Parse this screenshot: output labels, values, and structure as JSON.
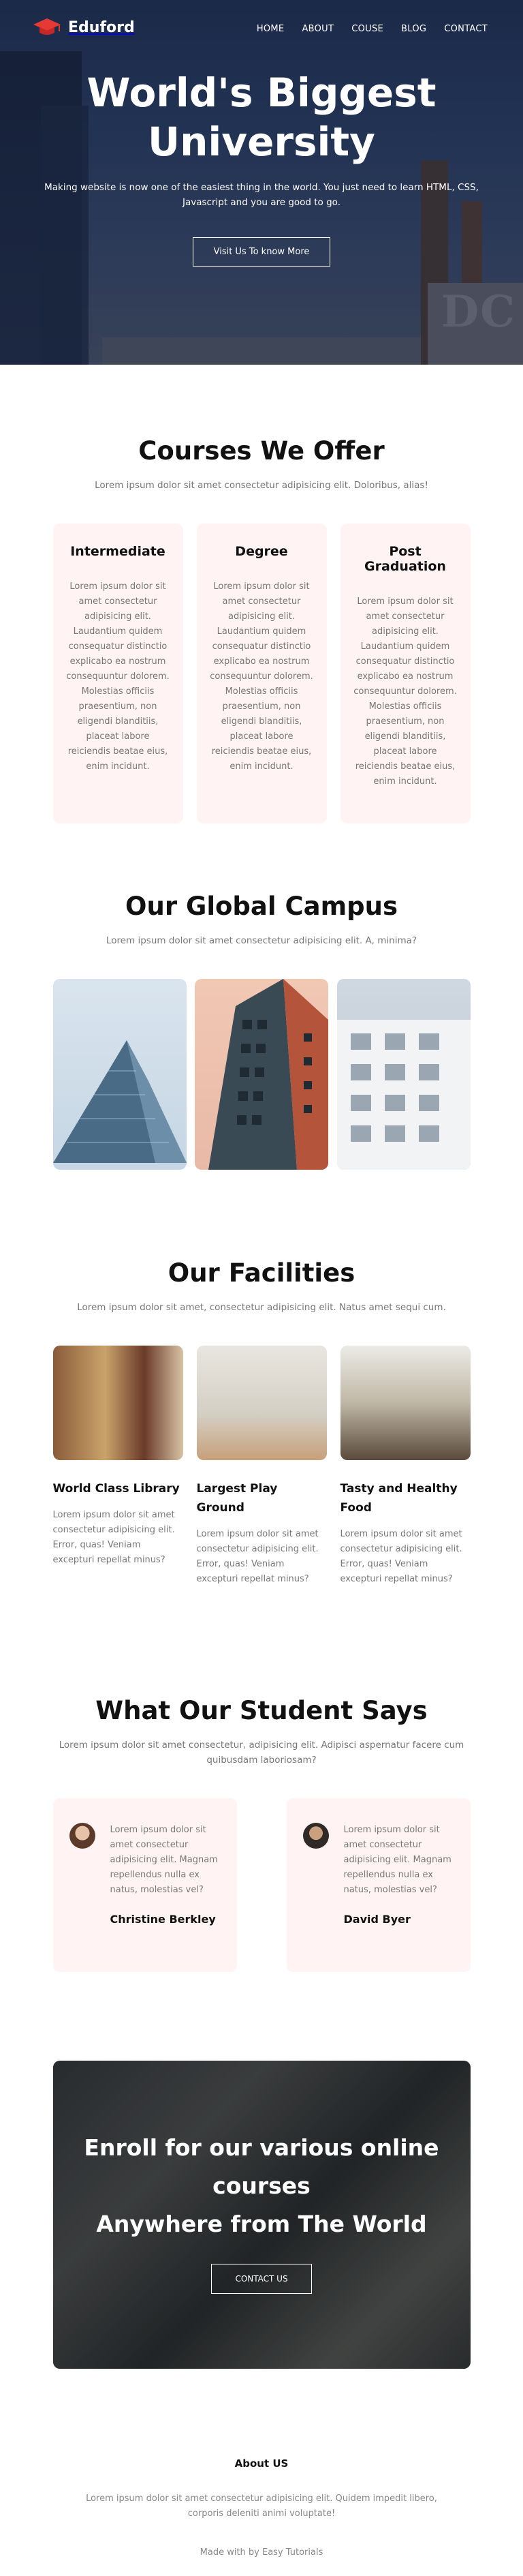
{
  "brand": {
    "name": "Eduford",
    "accent": "#f44336"
  },
  "nav": {
    "links": [
      "HOME",
      "ABOUT",
      "COUSE",
      "BLOG",
      "CONTACT"
    ]
  },
  "hero": {
    "title": "World's Biggest University",
    "subtitle": "Making website is now one of the easiest thing in the world. You just need to learn HTML, CSS, Javascript and you are good to go.",
    "button": "Visit Us To know More",
    "watermark": "DC"
  },
  "courses": {
    "title": "Courses We Offer",
    "subtitle": "Lorem ipsum dolor sit amet consectetur adipisicing elit. Doloribus, alias!",
    "items": [
      {
        "title": "Intermediate",
        "text": "Lorem ipsum dolor sit amet consectetur adipisicing elit. Laudantium quidem consequatur distinctio explicabo ea nostrum consequuntur dolorem. Molestias officiis praesentium, non eligendi blanditiis, placeat labore reiciendis beatae eius, enim incidunt."
      },
      {
        "title": "Degree",
        "text": "Lorem ipsum dolor sit amet consectetur adipisicing elit. Laudantium quidem consequatur distinctio explicabo ea nostrum consequuntur dolorem. Molestias officiis praesentium, non eligendi blanditiis, placeat labore reiciendis beatae eius, enim incidunt."
      },
      {
        "title": "Post Graduation",
        "text": "Lorem ipsum dolor sit amet consectetur adipisicing elit. Laudantium quidem consequatur distinctio explicabo ea nostrum consequuntur dolorem. Molestias officiis praesentium, non eligendi blanditiis, placeat labore reiciendis beatae eius, enim incidunt."
      }
    ]
  },
  "campus": {
    "title": "Our Global Campus",
    "subtitle": "Lorem ipsum dolor sit amet consectetur adipisicing elit. A, minima?"
  },
  "facilities": {
    "title": "Our Facilities",
    "subtitle": "Lorem ipsum dolor sit amet, consectetur adipisicing elit. Natus amet sequi cum.",
    "items": [
      {
        "title": "World Class Library",
        "text": "Lorem ipsum dolor sit amet consectetur adipisicing elit. Error, quas! Veniam excepturi repellat minus?"
      },
      {
        "title": "Largest Play Ground",
        "text": "Lorem ipsum dolor sit amet consectetur adipisicing elit. Error, quas! Veniam excepturi repellat minus?"
      },
      {
        "title": "Tasty and Healthy Food",
        "text": "Lorem ipsum dolor sit amet consectetur adipisicing elit. Error, quas! Veniam excepturi repellat minus?"
      }
    ]
  },
  "testimonials": {
    "title": "What Our Student Says",
    "subtitle": "Lorem ipsum dolor sit amet consectetur, adipisicing elit. Adipisci aspernatur facere cum quibusdam laboriosam?",
    "items": [
      {
        "text": "Lorem ipsum dolor sit amet consectetur adipisicing elit. Magnam repellendus nulla ex natus, molestias vel?",
        "name": "Christine Berkley"
      },
      {
        "text": "Lorem ipsum dolor sit amet consectetur adipisicing elit. Magnam repellendus nulla ex natus, molestias vel?",
        "name": "David Byer"
      }
    ]
  },
  "cta": {
    "line1": "Enroll for our various online courses",
    "line2": "Anywhere from The World",
    "button": "CONTACT US"
  },
  "footer": {
    "heading": "About US",
    "text": "Lorem ipsum dolor sit amet consectetur adipisicing elit. Quidem impedit libero, corporis deleniti animi voluptate!",
    "made": "Made with by Easy Tutorials"
  }
}
